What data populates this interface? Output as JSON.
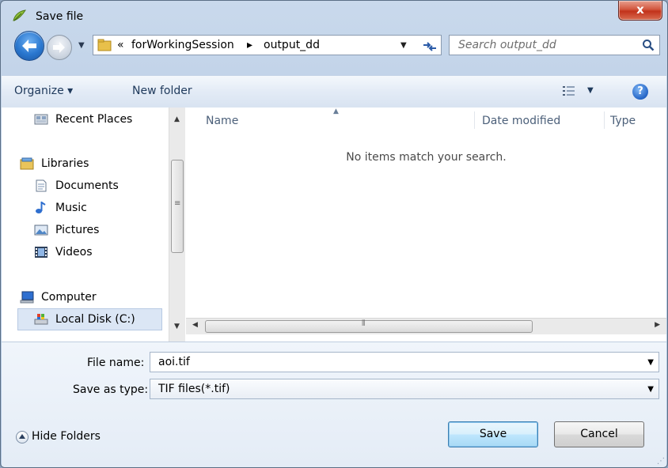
{
  "window": {
    "title": "Save file",
    "close_label": "x"
  },
  "navigation": {
    "breadcrumb_prefix": "«",
    "breadcrumb": [
      "forWorkingSession",
      "output_dd"
    ],
    "breadcrumb_separator": "▸",
    "search_placeholder": "Search output_dd"
  },
  "toolbar": {
    "organize_label": "Organize ▾",
    "new_folder_label": "New folder",
    "help_label": "?"
  },
  "sidebar": {
    "items": [
      {
        "label": "Recent Places",
        "icon": "recent-places-icon"
      },
      {
        "label": "Libraries",
        "icon": "libraries-icon"
      },
      {
        "label": "Documents",
        "icon": "documents-icon"
      },
      {
        "label": "Music",
        "icon": "music-icon"
      },
      {
        "label": "Pictures",
        "icon": "pictures-icon"
      },
      {
        "label": "Videos",
        "icon": "videos-icon"
      },
      {
        "label": "Computer",
        "icon": "computer-icon"
      },
      {
        "label": "Local Disk (C:)",
        "icon": "local-disk-icon"
      }
    ]
  },
  "file_list": {
    "columns": [
      "Name",
      "Date modified",
      "Type"
    ],
    "empty_message": "No items match your search."
  },
  "form": {
    "file_name_label": "File name:",
    "file_name_value": "aoi.tif",
    "save_type_label": "Save as type:",
    "save_type_value": "TIF files(*.tif)"
  },
  "footer": {
    "hide_folders_label": "Hide Folders",
    "save_label": "Save",
    "cancel_label": "Cancel"
  },
  "colors": {
    "accent": "#2a77cf",
    "selection": "#dbe6f5",
    "close": "#c2321b"
  }
}
